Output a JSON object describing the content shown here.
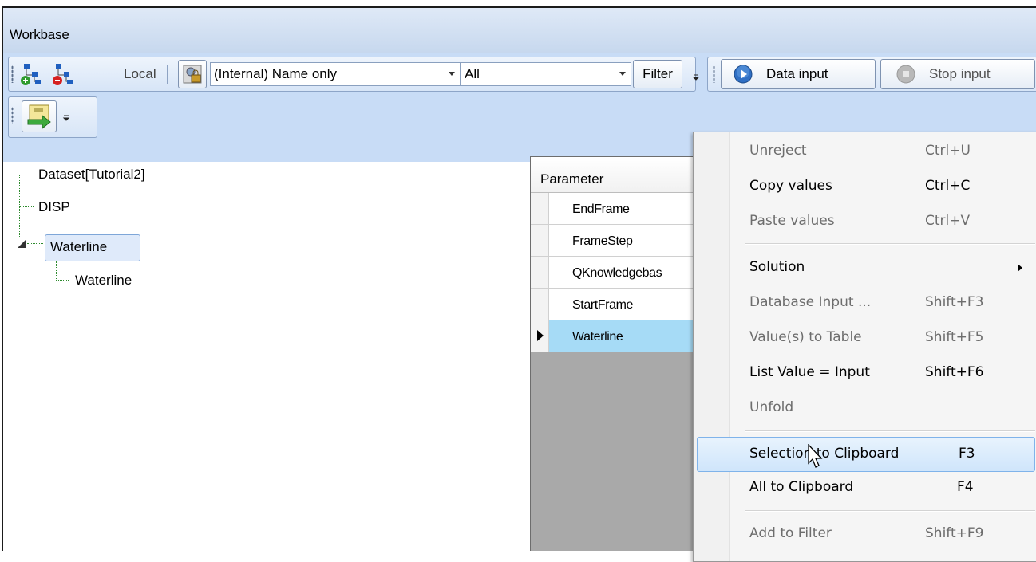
{
  "window": {
    "title": "Workbase"
  },
  "toolbar": {
    "local_label": "Local",
    "name_combo": "(Internal) Name only",
    "scope_combo": "All",
    "filter_label": "Filter",
    "data_input_label": "Data input",
    "stop_input_label": "Stop input"
  },
  "tree": {
    "items": [
      "Dataset[Tutorial2]",
      "DISP",
      "Waterline",
      "Waterline"
    ]
  },
  "grid": {
    "header": "Parameter",
    "rows": [
      "EndFrame",
      "FrameStep",
      "QKnowledgebas",
      "StartFrame",
      "Waterline"
    ],
    "selected_row": "Waterline"
  },
  "context_menu": {
    "items": [
      {
        "label": "Unreject",
        "shortcut": "Ctrl+U",
        "enabled": false
      },
      {
        "label": "Copy values",
        "shortcut": "Ctrl+C",
        "enabled": true
      },
      {
        "label": "Paste values",
        "shortcut": "Ctrl+V",
        "enabled": false
      },
      {
        "label": "Solution",
        "shortcut": "",
        "enabled": true,
        "submenu": true
      },
      {
        "label": "Database Input ...",
        "shortcut": "Shift+F3",
        "enabled": false
      },
      {
        "label": "Value(s) to Table",
        "shortcut": "Shift+F5",
        "enabled": false
      },
      {
        "label": "List Value = Input",
        "shortcut": "Shift+F6",
        "enabled": true
      },
      {
        "label": "Unfold",
        "shortcut": "",
        "enabled": false
      },
      {
        "label": "Selection to Clipboard",
        "shortcut": "F3",
        "enabled": true,
        "hovered": true
      },
      {
        "label": "All to Clipboard",
        "shortcut": "F4",
        "enabled": true
      },
      {
        "label": "Add to Filter",
        "shortcut": "Shift+F9",
        "enabled": false
      }
    ]
  },
  "colors": {
    "toolbar_band": "#c8dcf6",
    "selected_row": "#a6dbf6",
    "tree_line": "#2e8b2e",
    "menu_hover_border": "#7fb3ea"
  }
}
